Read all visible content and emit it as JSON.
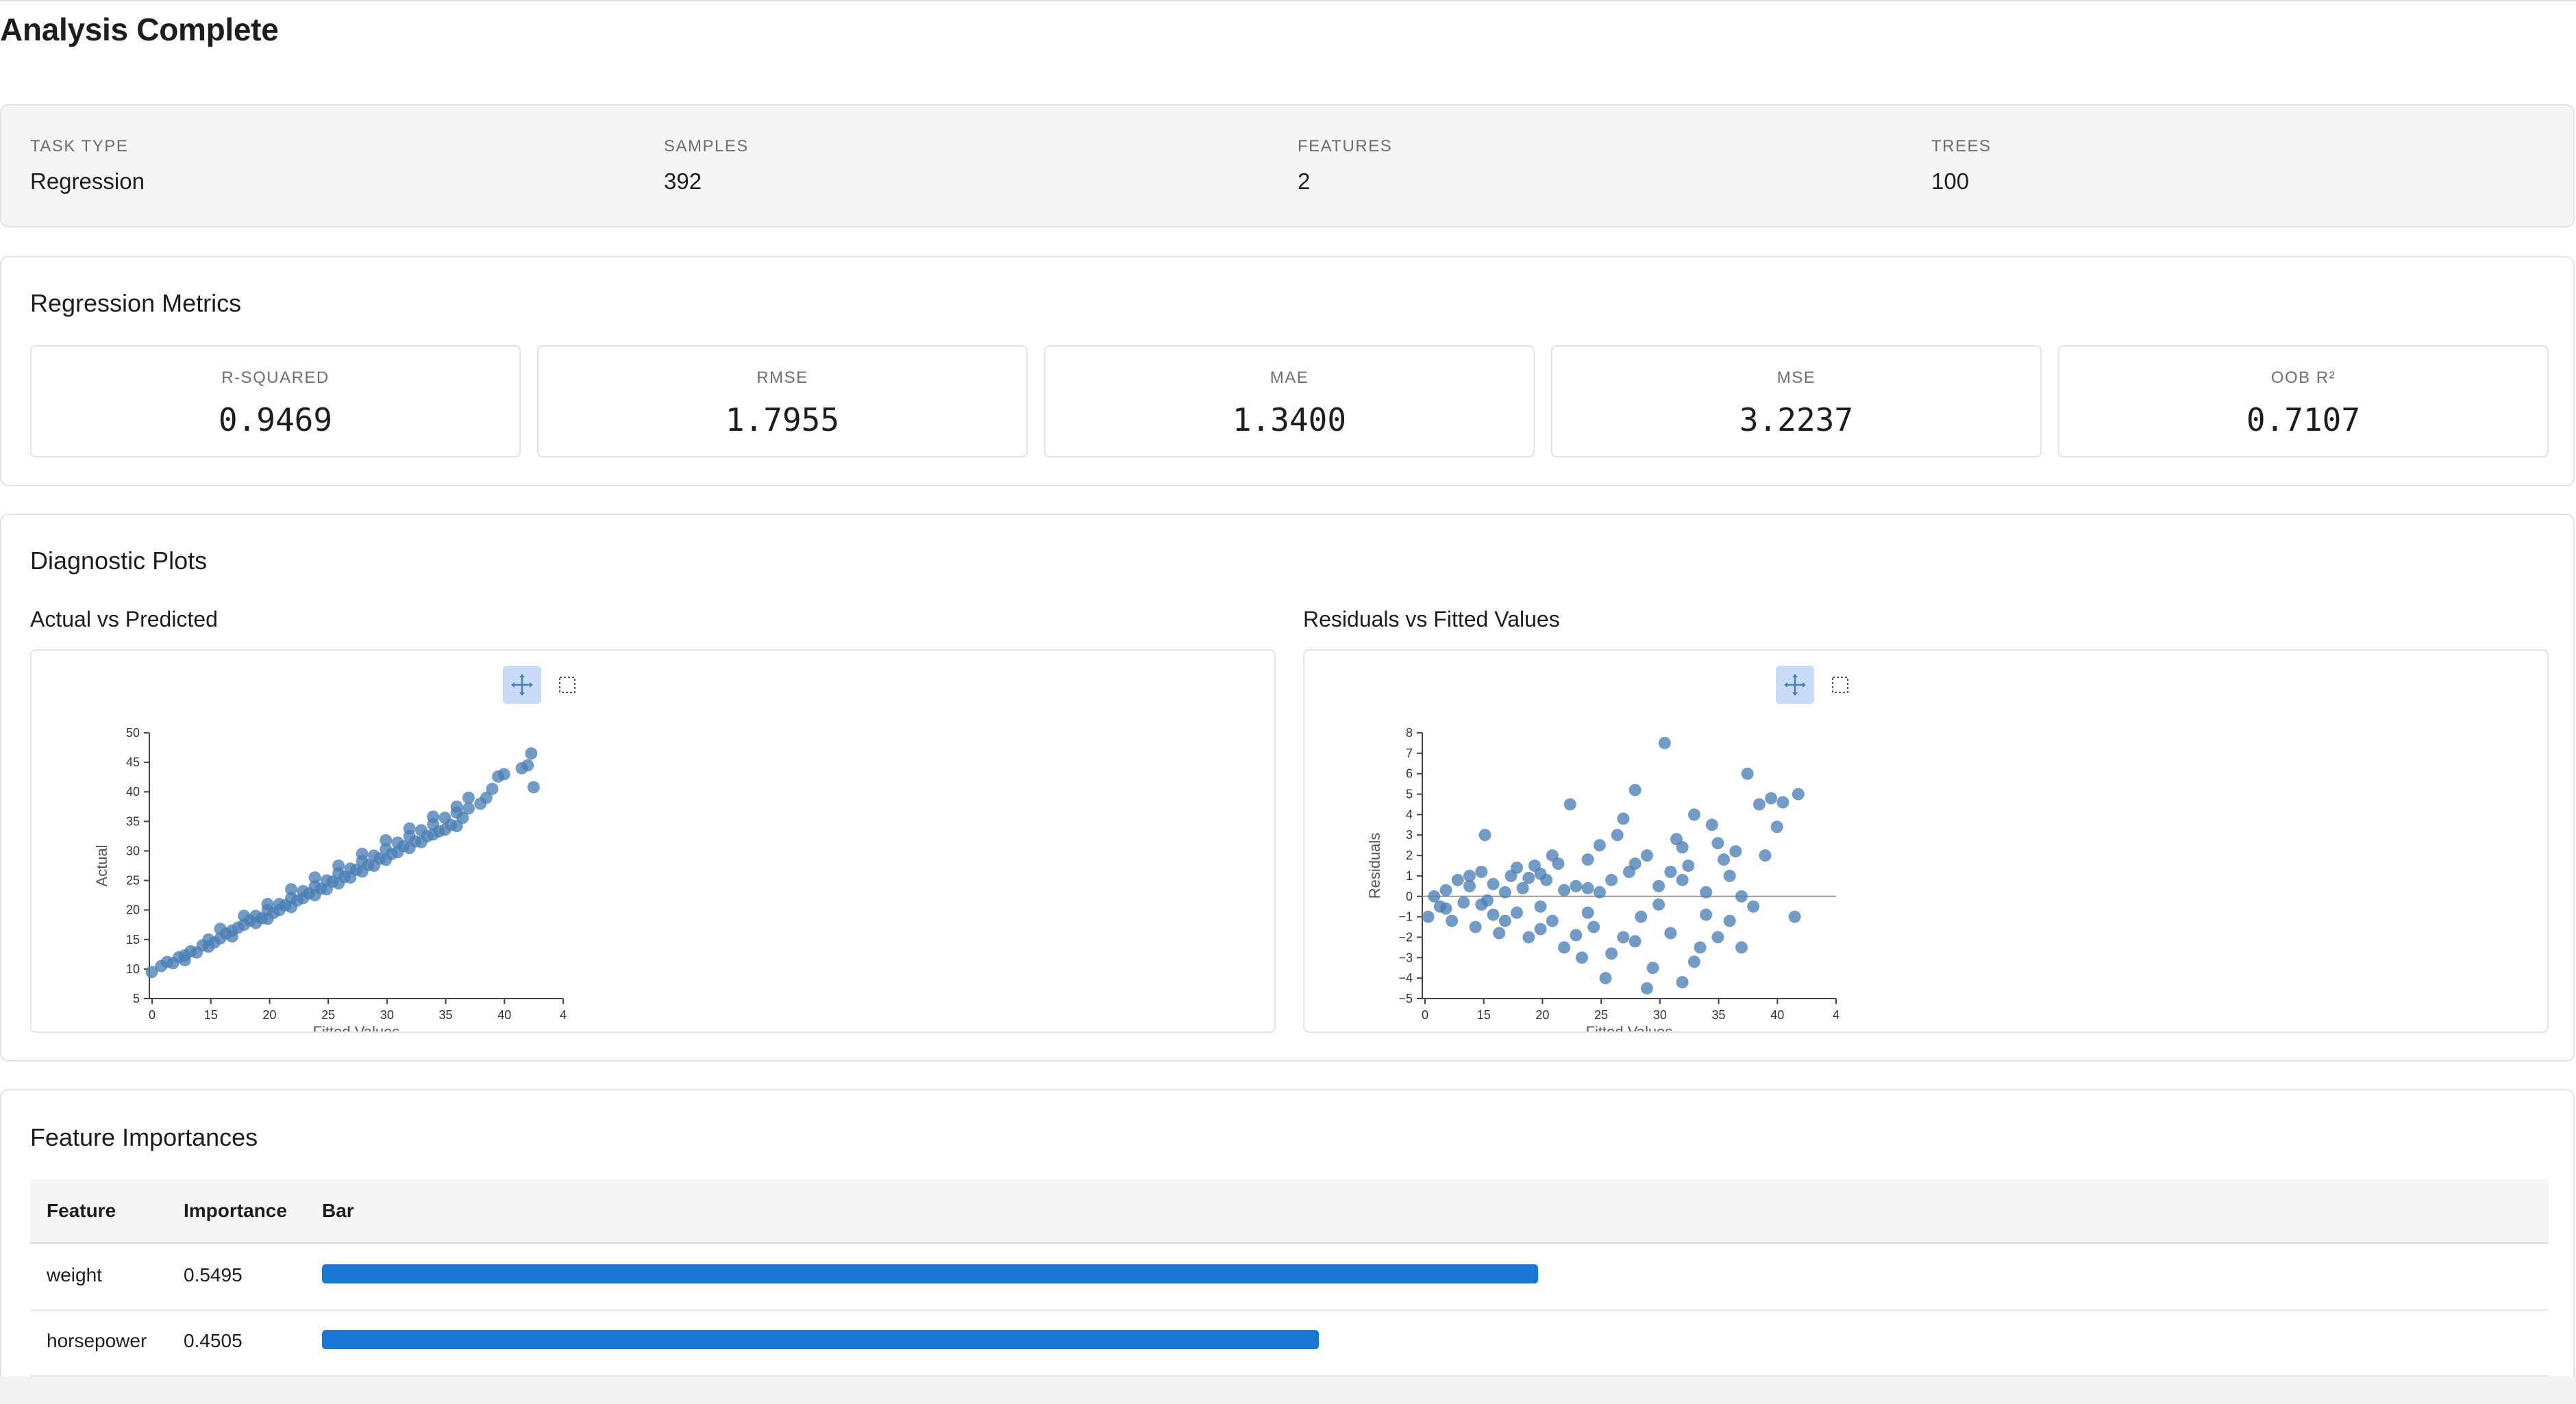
{
  "header": {
    "title": "Analysis Complete"
  },
  "summary": [
    {
      "label": "TASK TYPE",
      "value": "Regression"
    },
    {
      "label": "SAMPLES",
      "value": "392"
    },
    {
      "label": "FEATURES",
      "value": "2"
    },
    {
      "label": "TREES",
      "value": "100"
    }
  ],
  "metrics": {
    "title": "Regression Metrics",
    "items": [
      {
        "label": "R-SQUARED",
        "value": "0.9469"
      },
      {
        "label": "RMSE",
        "value": "1.7955"
      },
      {
        "label": "MAE",
        "value": "1.3400"
      },
      {
        "label": "MSE",
        "value": "3.2237"
      },
      {
        "label": "OOB R²",
        "value": "0.7107"
      }
    ]
  },
  "diagnostics": {
    "title": "Diagnostic Plots",
    "toolbar": {
      "pan_icon": "pan-icon",
      "box_select_icon": "box-select-icon",
      "active_color": "#c9dcf7"
    }
  },
  "chart_data": [
    {
      "type": "scatter",
      "title": "Actual vs Predicted",
      "xlabel": "Fitted Values",
      "ylabel": "Actual",
      "x_ticks": [
        "0",
        "15",
        "20",
        "25",
        "30",
        "35",
        "40",
        "4"
      ],
      "y_ticks": [
        "5",
        "10",
        "15",
        "20",
        "25",
        "30",
        "35",
        "40",
        "45",
        "50"
      ],
      "xlim": [
        10,
        45
      ],
      "ylim": [
        5,
        50
      ],
      "color": "#4a7fb5",
      "points": [
        [
          10.2,
          9.5
        ],
        [
          11,
          10.5
        ],
        [
          11.5,
          11.2
        ],
        [
          12,
          11
        ],
        [
          12.5,
          12
        ],
        [
          13,
          12.3
        ],
        [
          13.5,
          13
        ],
        [
          14,
          12.8
        ],
        [
          14.5,
          14
        ],
        [
          15,
          13.8
        ],
        [
          15.5,
          14.5
        ],
        [
          16,
          15.2
        ],
        [
          16.5,
          16
        ],
        [
          17,
          16.5
        ],
        [
          17.5,
          17
        ],
        [
          18,
          17.5
        ],
        [
          18.5,
          18.2
        ],
        [
          19,
          19
        ],
        [
          19.5,
          18.6
        ],
        [
          20,
          20
        ],
        [
          20.5,
          19.5
        ],
        [
          21,
          21
        ],
        [
          21.5,
          20.8
        ],
        [
          22,
          22
        ],
        [
          22.5,
          21.6
        ],
        [
          23,
          23.2
        ],
        [
          23.5,
          22.8
        ],
        [
          24,
          24
        ],
        [
          24.5,
          23.6
        ],
        [
          25,
          25
        ],
        [
          25.5,
          24.8
        ],
        [
          26,
          26.2
        ],
        [
          26.5,
          25.6
        ],
        [
          27,
          27
        ],
        [
          27.5,
          26.8
        ],
        [
          28,
          28.3
        ],
        [
          28.5,
          27.6
        ],
        [
          29,
          29.2
        ],
        [
          29.5,
          28.7
        ],
        [
          30,
          30.3
        ],
        [
          30.5,
          29.5
        ],
        [
          31,
          31.4
        ],
        [
          31.5,
          30.8
        ],
        [
          32,
          32.5
        ],
        [
          32.5,
          31.6
        ],
        [
          33,
          33.5
        ],
        [
          33.5,
          32.5
        ],
        [
          34,
          34.5
        ],
        [
          34.5,
          33.3
        ],
        [
          35,
          35.6
        ],
        [
          35.5,
          34.4
        ],
        [
          36,
          36.5
        ],
        [
          36.5,
          35.6
        ],
        [
          37,
          37.2
        ],
        [
          38,
          38
        ],
        [
          38.5,
          39
        ],
        [
          39,
          40.5
        ],
        [
          39.5,
          42.6
        ],
        [
          40,
          43
        ],
        [
          41.5,
          44
        ],
        [
          42,
          44.5
        ],
        [
          42.5,
          40.8
        ],
        [
          42.3,
          46.5
        ],
        [
          13,
          11.5
        ],
        [
          15,
          15
        ],
        [
          17,
          15.5
        ],
        [
          19,
          17.8
        ],
        [
          20,
          18.5
        ],
        [
          21,
          20
        ],
        [
          22,
          20.5
        ],
        [
          23,
          22
        ],
        [
          24,
          22.5
        ],
        [
          25,
          23.5
        ],
        [
          26,
          24.5
        ],
        [
          27,
          25.5
        ],
        [
          28,
          26.5
        ],
        [
          29,
          27.5
        ],
        [
          30,
          28.5
        ],
        [
          31,
          29.8
        ],
        [
          32,
          30.5
        ],
        [
          33,
          31.5
        ],
        [
          34,
          32.8
        ],
        [
          35,
          33.6
        ],
        [
          36,
          34.2
        ],
        [
          16,
          16.8
        ],
        [
          18,
          19
        ],
        [
          20,
          21
        ],
        [
          22,
          23.5
        ],
        [
          24,
          25.5
        ],
        [
          26,
          27.5
        ],
        [
          28,
          29.5
        ],
        [
          30,
          31.8
        ],
        [
          32,
          33.8
        ],
        [
          34,
          35.8
        ],
        [
          36,
          37.5
        ],
        [
          37,
          39
        ]
      ]
    },
    {
      "type": "scatter",
      "title": "Residuals vs Fitted Values",
      "xlabel": "Fitted Values",
      "ylabel": "Residuals",
      "x_ticks": [
        "0",
        "15",
        "20",
        "25",
        "30",
        "35",
        "40",
        "4"
      ],
      "y_ticks": [
        "−5",
        "−4",
        "−3",
        "−2",
        "−1",
        "0",
        "1",
        "2",
        "3",
        "4",
        "5",
        "6",
        "7",
        "8"
      ],
      "xlim": [
        10,
        45
      ],
      "ylim": [
        -5,
        8
      ],
      "reference_line": 0,
      "color": "#4a7fb5",
      "points": [
        [
          10.5,
          -1
        ],
        [
          11,
          0
        ],
        [
          11.5,
          -0.5
        ],
        [
          12,
          0.3
        ],
        [
          12.5,
          -1.2
        ],
        [
          13,
          0.8
        ],
        [
          13.5,
          -0.3
        ],
        [
          14,
          0.5
        ],
        [
          14.5,
          -1.5
        ],
        [
          15,
          1.2
        ],
        [
          15.3,
          3
        ],
        [
          15.5,
          -0.2
        ],
        [
          16,
          0.6
        ],
        [
          16.5,
          -1.8
        ],
        [
          17,
          0.2
        ],
        [
          17.5,
          1
        ],
        [
          18,
          -0.8
        ],
        [
          18.5,
          0.4
        ],
        [
          19,
          -2
        ],
        [
          19.5,
          1.5
        ],
        [
          20,
          -0.5
        ],
        [
          20.5,
          0.8
        ],
        [
          21,
          -1.2
        ],
        [
          21.5,
          1.6
        ],
        [
          22,
          -2.5
        ],
        [
          22.5,
          4.5
        ],
        [
          23,
          0.5
        ],
        [
          23.5,
          -3
        ],
        [
          24,
          1.8
        ],
        [
          24.5,
          -1.5
        ],
        [
          25,
          2.5
        ],
        [
          25.5,
          -4
        ],
        [
          26,
          0.8
        ],
        [
          26.5,
          3
        ],
        [
          27,
          -2
        ],
        [
          27.5,
          1.2
        ],
        [
          28,
          5.2
        ],
        [
          28.5,
          -1
        ],
        [
          29,
          2
        ],
        [
          29.5,
          -3.5
        ],
        [
          30,
          0.5
        ],
        [
          30.5,
          7.5
        ],
        [
          31,
          -1.8
        ],
        [
          31.5,
          2.8
        ],
        [
          32,
          -4.2
        ],
        [
          32.5,
          1.5
        ],
        [
          33,
          4
        ],
        [
          33.5,
          -2.5
        ],
        [
          34,
          0.2
        ],
        [
          34.5,
          3.5
        ],
        [
          35,
          -2
        ],
        [
          35.5,
          1.8
        ],
        [
          36,
          -1.2
        ],
        [
          36.5,
          2.2
        ],
        [
          37,
          0
        ],
        [
          37.5,
          6
        ],
        [
          38,
          -0.5
        ],
        [
          38.5,
          4.5
        ],
        [
          39,
          2
        ],
        [
          39.5,
          4.8
        ],
        [
          40,
          3.4
        ],
        [
          40.5,
          4.6
        ],
        [
          41.5,
          -1
        ],
        [
          41.8,
          5
        ],
        [
          12,
          -0.6
        ],
        [
          14,
          1
        ],
        [
          16,
          -0.9
        ],
        [
          18,
          1.4
        ],
        [
          20,
          -1.6
        ],
        [
          22,
          0.3
        ],
        [
          24,
          -0.8
        ],
        [
          26,
          -2.8
        ],
        [
          28,
          1.6
        ],
        [
          30,
          -0.4
        ],
        [
          32,
          2.4
        ],
        [
          34,
          -0.9
        ],
        [
          36,
          1
        ],
        [
          15,
          -0.4
        ],
        [
          17,
          -1.2
        ],
        [
          19,
          0.9
        ],
        [
          21,
          2
        ],
        [
          23,
          -1.9
        ],
        [
          25,
          0.2
        ],
        [
          27,
          3.8
        ],
        [
          29,
          -4.5
        ],
        [
          31,
          1.2
        ],
        [
          33,
          -3.2
        ],
        [
          35,
          2.6
        ],
        [
          37,
          -2.5
        ],
        [
          20,
          1.1
        ],
        [
          24,
          0.4
        ],
        [
          28,
          -2.2
        ],
        [
          32,
          0.8
        ]
      ]
    }
  ],
  "features": {
    "title": "Feature Importances",
    "columns": [
      "Feature",
      "Importance",
      "Bar"
    ],
    "bar_color": "#1976d2",
    "rows": [
      {
        "feature": "weight",
        "importance": "0.5495",
        "fraction": 0.5495
      },
      {
        "feature": "horsepower",
        "importance": "0.4505",
        "fraction": 0.4505
      }
    ]
  }
}
